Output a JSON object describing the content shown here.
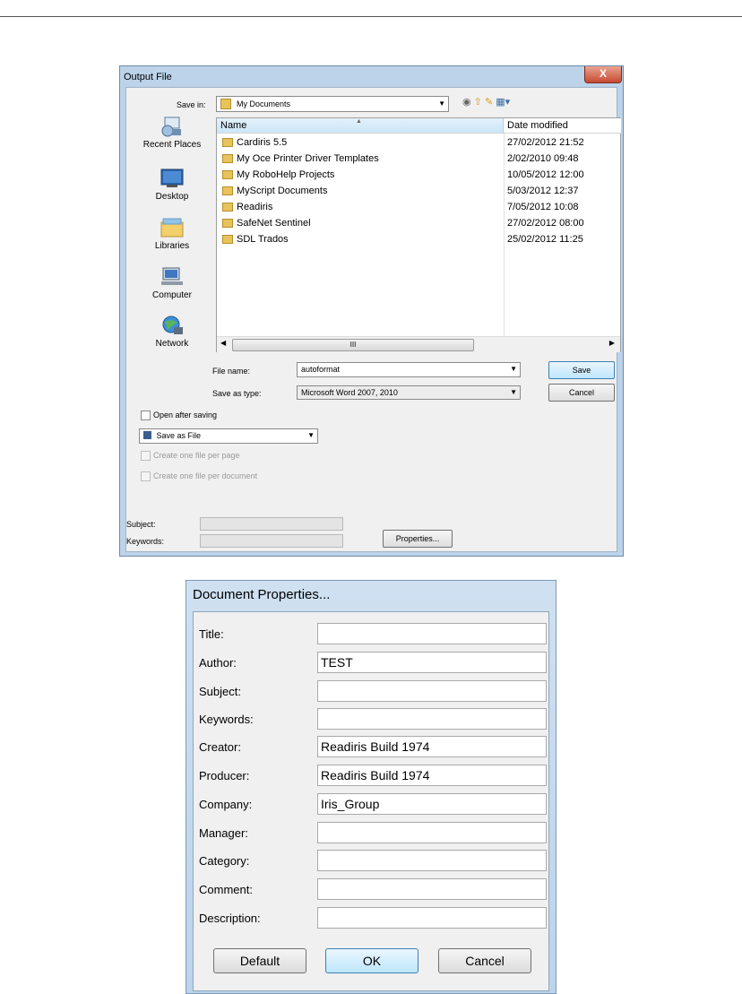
{
  "output_dialog": {
    "title": "Output File",
    "close_glyph": "X",
    "save_in_label": "Save in:",
    "save_in_value": "My Documents",
    "places": [
      {
        "label": "Recent Places",
        "icon": "recent-places-icon"
      },
      {
        "label": "Desktop",
        "icon": "desktop-icon"
      },
      {
        "label": "Libraries",
        "icon": "libraries-icon"
      },
      {
        "label": "Computer",
        "icon": "computer-icon"
      },
      {
        "label": "Network",
        "icon": "network-icon"
      }
    ],
    "columns": {
      "name": "Name",
      "date": "Date modified"
    },
    "files": [
      {
        "name": "Cardiris 5.5",
        "date": "27/02/2012 21:52"
      },
      {
        "name": "My Oce Printer Driver Templates",
        "date": "2/02/2010 09:48"
      },
      {
        "name": "My RoboHelp Projects",
        "date": "10/05/2012 12:00"
      },
      {
        "name": "MyScript Documents",
        "date": "5/03/2012 12:37"
      },
      {
        "name": "Readiris",
        "date": "7/05/2012 10:08"
      },
      {
        "name": "SafeNet Sentinel",
        "date": "27/02/2012 08:00"
      },
      {
        "name": "SDL Trados",
        "date": "25/02/2012 11:25"
      }
    ],
    "scroll_thumb_glyph": "III",
    "file_name_label": "File name:",
    "file_name_value": "autoformat",
    "save_as_type_label": "Save as type:",
    "save_as_type_value": "Microsoft Word 2007, 2010",
    "save_button": "Save",
    "cancel_button": "Cancel",
    "open_after_saving": "Open after saving",
    "save_mode": "Save as File",
    "one_file_per_page": "Create one file per page",
    "one_file_per_document": "Create one file per document",
    "subject_label": "Subject:",
    "keywords_label": "Keywords:",
    "properties_button": "Properties..."
  },
  "properties_dialog": {
    "title": "Document Properties...",
    "fields": [
      {
        "label": "Title:",
        "value": ""
      },
      {
        "label": "Author:",
        "value": "TEST"
      },
      {
        "label": "Subject:",
        "value": ""
      },
      {
        "label": "Keywords:",
        "value": ""
      },
      {
        "label": "Creator:",
        "value": "Readiris Build 1974"
      },
      {
        "label": "Producer:",
        "value": "Readiris Build 1974"
      },
      {
        "label": "Company:",
        "value": "Iris_Group"
      },
      {
        "label": "Manager:",
        "value": ""
      },
      {
        "label": "Category:",
        "value": ""
      },
      {
        "label": "Comment:",
        "value": ""
      },
      {
        "label": "Description:",
        "value": ""
      }
    ],
    "default_button": "Default",
    "ok_button": "OK",
    "cancel_button": "Cancel"
  }
}
